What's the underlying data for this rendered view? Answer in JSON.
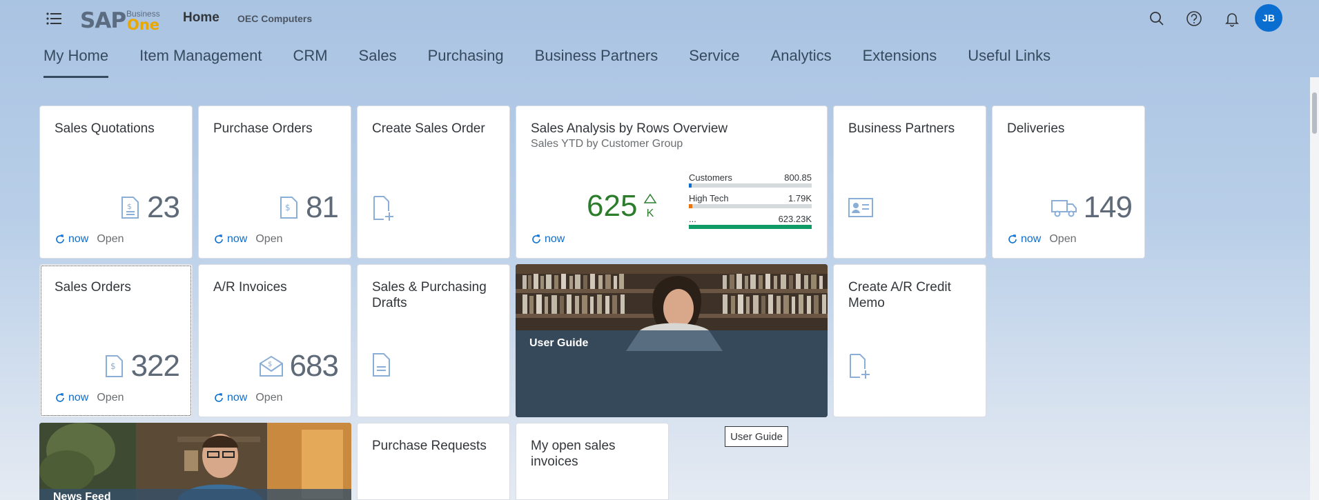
{
  "header": {
    "logo_main": "SAP",
    "logo_business": "Business",
    "logo_one": "One",
    "title": "Home",
    "company": "OEC Computers",
    "avatar_initials": "JB"
  },
  "tabs": [
    {
      "label": "My Home",
      "active": true
    },
    {
      "label": "Item Management"
    },
    {
      "label": "CRM"
    },
    {
      "label": "Sales"
    },
    {
      "label": "Purchasing"
    },
    {
      "label": "Business Partners"
    },
    {
      "label": "Service"
    },
    {
      "label": "Analytics"
    },
    {
      "label": "Extensions"
    },
    {
      "label": "Useful Links"
    }
  ],
  "tiles": {
    "sales_quotations": {
      "title": "Sales Quotations",
      "value": "23",
      "refresh": "now",
      "status": "Open"
    },
    "purchase_orders": {
      "title": "Purchase Orders",
      "value": "81",
      "refresh": "now",
      "status": "Open"
    },
    "create_sales_order": {
      "title": "Create Sales Order"
    },
    "sales_analysis": {
      "title": "Sales Analysis by Rows Overview",
      "subtitle": "Sales YTD by Customer Group",
      "value": "625",
      "unit": "K",
      "refresh": "now",
      "rows": [
        {
          "label": "Customers",
          "value": "800.85",
          "fraction": 0.02,
          "color": "#0a6ed1"
        },
        {
          "label": "High Tech",
          "value": "1.79K",
          "fraction": 0.03,
          "color": "#e9730c"
        },
        {
          "label": "...",
          "value": "623.23K",
          "fraction": 1.0,
          "color": "#0e9b65"
        }
      ]
    },
    "business_partners": {
      "title": "Business Partners"
    },
    "deliveries": {
      "title": "Deliveries",
      "value": "149",
      "refresh": "now",
      "status": "Open"
    },
    "sales_orders": {
      "title": "Sales Orders",
      "value": "322",
      "refresh": "now",
      "status": "Open"
    },
    "ar_invoices": {
      "title": "A/R Invoices",
      "value": "683",
      "refresh": "now",
      "status": "Open"
    },
    "sp_drafts": {
      "title": "Sales & Purchasing Drafts"
    },
    "user_guide": {
      "title": "User Guide"
    },
    "create_ar_credit": {
      "title": "Create A/R Credit Memo"
    },
    "news_feed": {
      "title": "News Feed"
    },
    "purchase_requests": {
      "title": "Purchase Requests"
    },
    "open_invoices": {
      "title": "My open sales invoices"
    }
  },
  "tooltip": "User Guide",
  "colors": {
    "accent": "#0a6ed1",
    "kpi_positive": "#2b7d2b",
    "shell_text": "#354a5f"
  }
}
